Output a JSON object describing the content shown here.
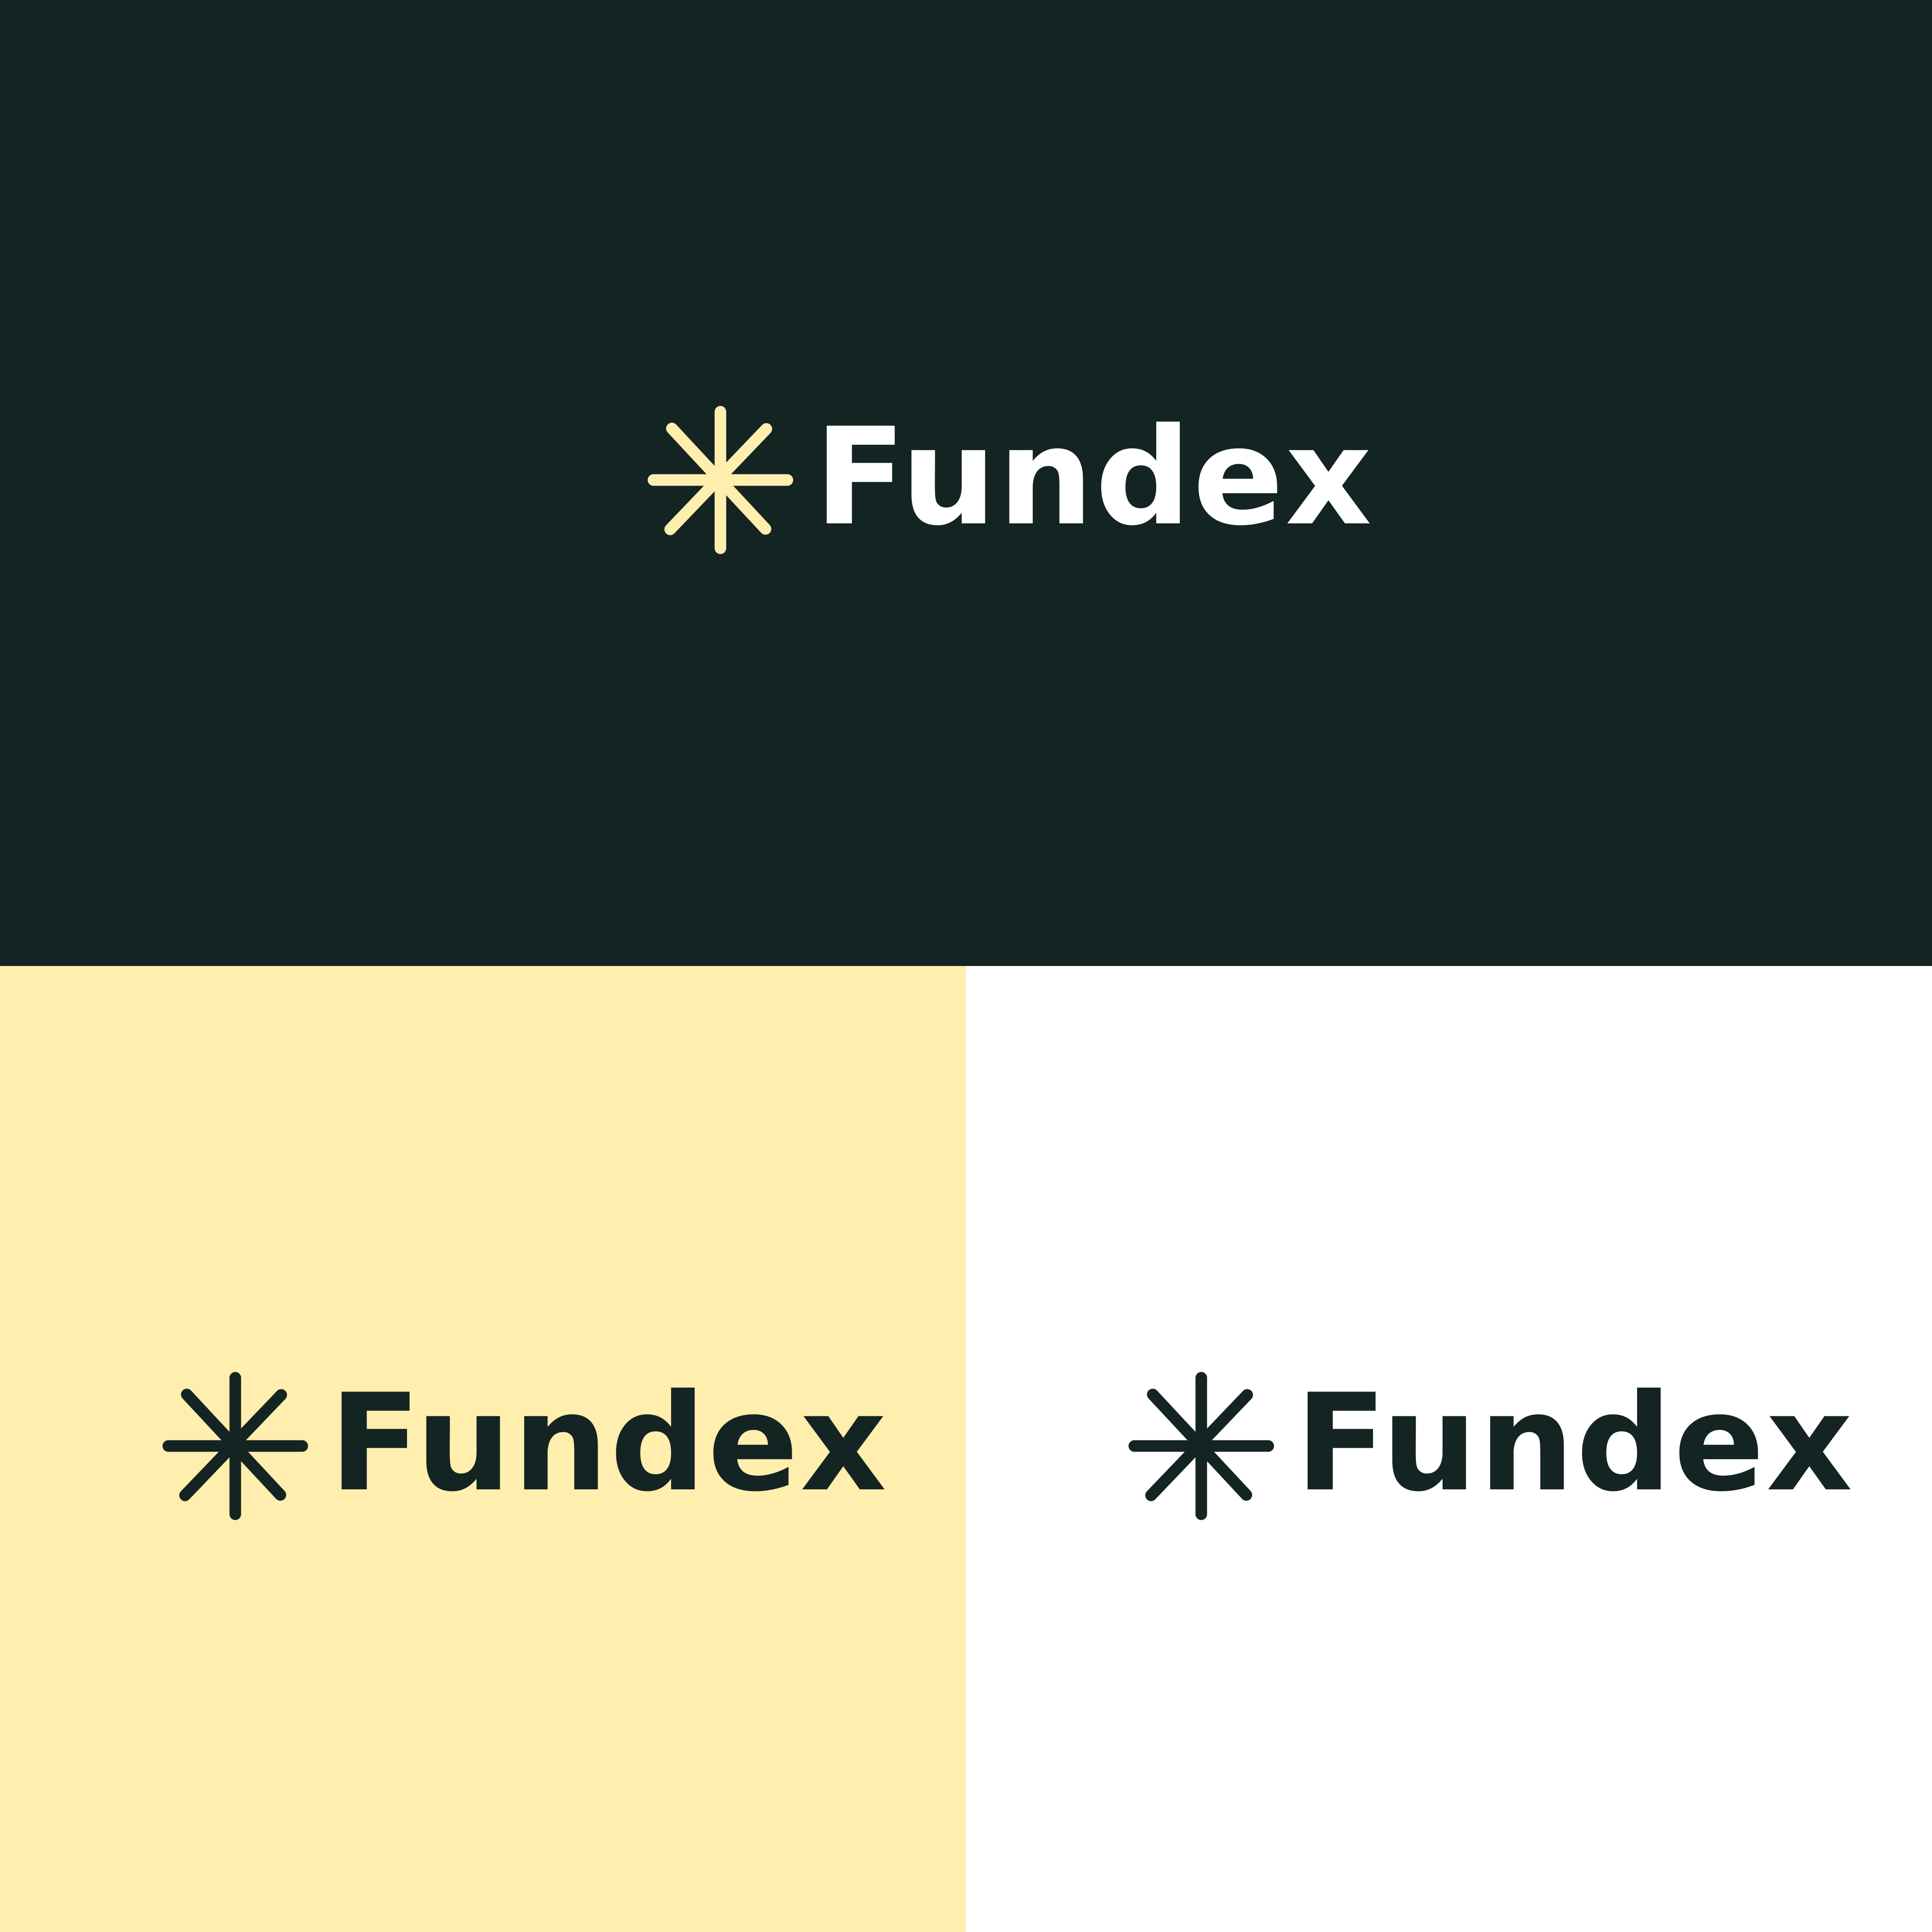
{
  "brand": {
    "name": "Fundex"
  },
  "colors": {
    "dark": "#132423",
    "cream": "#FFEEAD",
    "white": "#FFFFFF"
  },
  "icons": {
    "mark": "asterisk-sparkle-icon"
  },
  "panels": [
    {
      "id": "dark",
      "background": "#132423",
      "mark_color": "#FFEEAD",
      "text_color": "#FFFFFF"
    },
    {
      "id": "cream",
      "background": "#FFEEAD",
      "mark_color": "#132423",
      "text_color": "#132423"
    },
    {
      "id": "white",
      "background": "#FFFFFF",
      "mark_color": "#132423",
      "text_color": "#132423"
    }
  ]
}
